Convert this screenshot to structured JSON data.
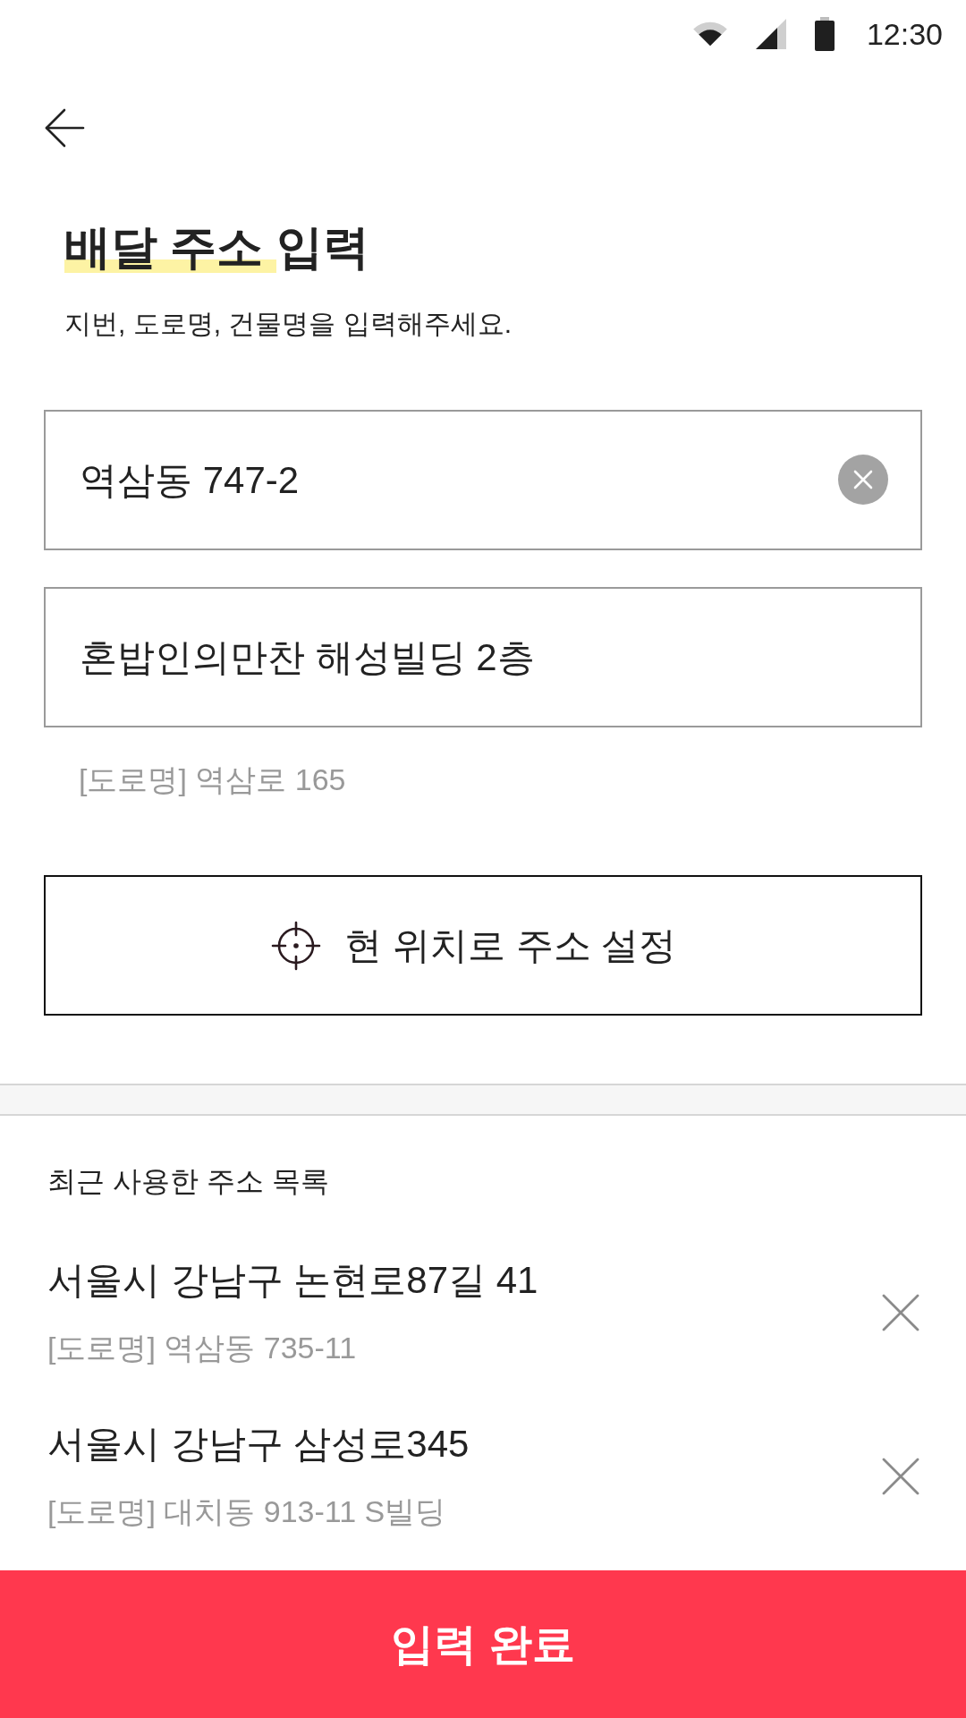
{
  "status_bar": {
    "time": "12:30"
  },
  "title_parts": [
    {
      "text": "배달 주소",
      "highlighted": true
    },
    {
      "text": "입력",
      "highlighted": false
    }
  ],
  "subtitle": "지번, 도로명, 건물명을 입력해주세요.",
  "fields": [
    {
      "value": "역삼동 747-2",
      "clear_button": true
    },
    {
      "value": "혼밥인의만찬 해성빌딩 2층",
      "clear_button": false
    }
  ],
  "road_address": "[도로명] 역삼로 165",
  "location_button": {
    "label": "현 위치로 주소 설정"
  },
  "recent": {
    "heading": "최근 사용한 주소 목록",
    "items": [
      {
        "address": "서울시 강남구 논현로87길 41",
        "detail": "[도로명] 역삼동 735-11"
      },
      {
        "address": "서울시 강남구 삼성로345",
        "detail": "[도로명] 대치동 913-11 S빌딩"
      }
    ]
  },
  "submit_button": {
    "label": "입력 완료"
  }
}
